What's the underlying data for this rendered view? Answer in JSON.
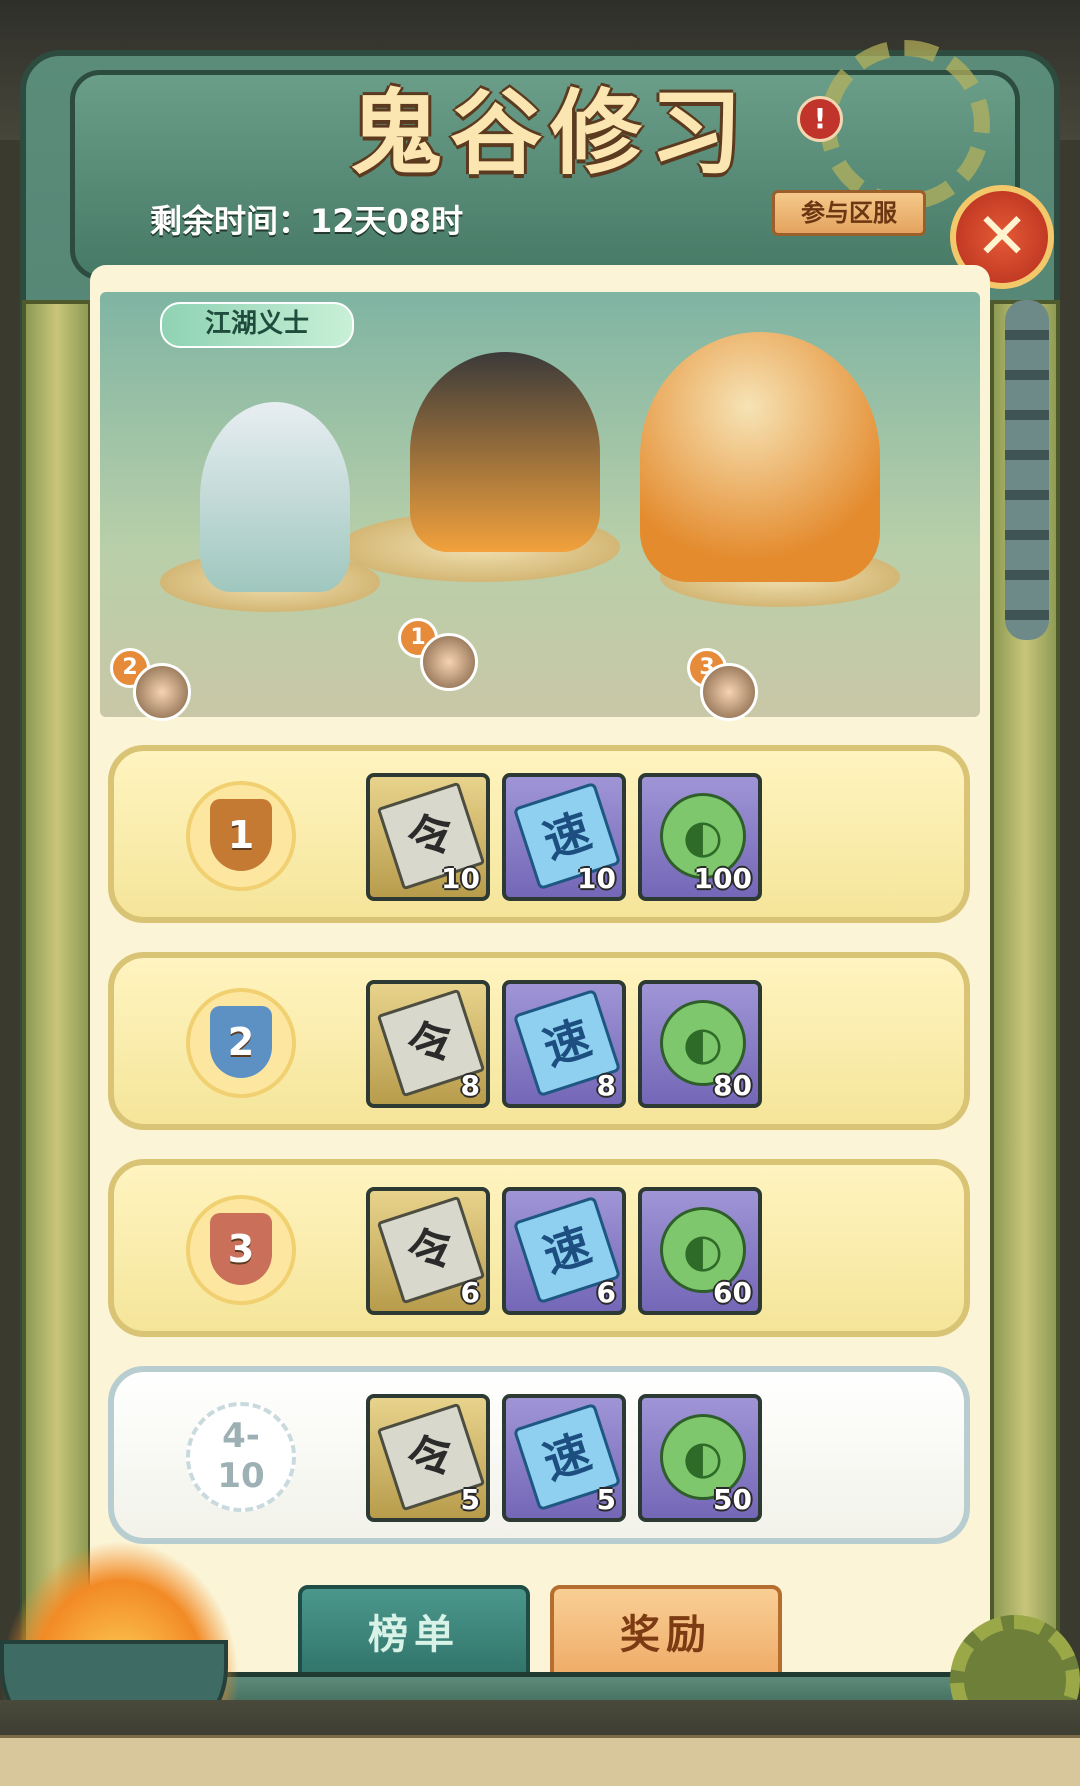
{
  "header": {
    "title": "鬼谷修习",
    "alert_symbol": "!",
    "timer": "剩余时间：12天08时",
    "server_button": "参与区服",
    "close_symbol": "✕"
  },
  "banner": {
    "tag": "江湖义士",
    "heroes": [
      {
        "rank": "2"
      },
      {
        "rank": "1"
      },
      {
        "rank": "3"
      }
    ]
  },
  "rewards": [
    {
      "rank": "1",
      "items": [
        {
          "icon": "令",
          "count": "10"
        },
        {
          "icon": "速",
          "count": "10"
        },
        {
          "icon": "jade-icon",
          "count": "100"
        }
      ]
    },
    {
      "rank": "2",
      "items": [
        {
          "icon": "令",
          "count": "8"
        },
        {
          "icon": "速",
          "count": "8"
        },
        {
          "icon": "jade-icon",
          "count": "80"
        }
      ]
    },
    {
      "rank": "3",
      "items": [
        {
          "icon": "令",
          "count": "6"
        },
        {
          "icon": "速",
          "count": "6"
        },
        {
          "icon": "jade-icon",
          "count": "60"
        }
      ]
    },
    {
      "rank_top": "4-",
      "rank_bottom": "10",
      "items": [
        {
          "icon": "令",
          "count": "5"
        },
        {
          "icon": "速",
          "count": "5"
        },
        {
          "icon": "jade-icon",
          "count": "50"
        }
      ]
    }
  ],
  "buttons": {
    "ranking": "榜单",
    "reward": "奖励"
  },
  "colors": {
    "rank1": "#c57a33",
    "rank2": "#5d91c4",
    "rank3": "#c96f5a"
  }
}
